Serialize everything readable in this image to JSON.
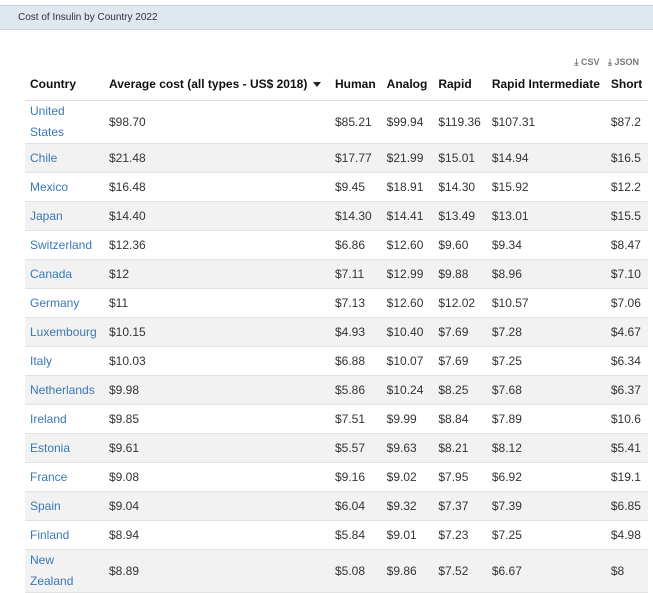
{
  "title": "Cost of Insulin by Country 2022",
  "downloads": {
    "csv": "⤓ CSV",
    "json": "⤓ JSON"
  },
  "columns": [
    "Country",
    "Average cost (all types - US$ 2018)",
    "Human",
    "Analog",
    "Rapid",
    "Rapid Intermediate",
    "Short"
  ],
  "rows": [
    [
      "United States",
      "$98.70",
      "$85.21",
      "$99.94",
      "$119.36",
      "$107.31",
      "$87.2"
    ],
    [
      "Chile",
      "$21.48",
      "$17.77",
      "$21.99",
      "$15.01",
      "$14.94",
      "$16.5"
    ],
    [
      "Mexico",
      "$16.48",
      "$9.45",
      "$18.91",
      "$14.30",
      "$15.92",
      "$12.2"
    ],
    [
      "Japan",
      "$14.40",
      "$14.30",
      "$14.41",
      "$13.49",
      "$13.01",
      "$15.5"
    ],
    [
      "Switzerland",
      "$12.36",
      "$6.86",
      "$12.60",
      "$9.60",
      "$9.34",
      "$8.47"
    ],
    [
      "Canada",
      "$12",
      "$7.11",
      "$12.99",
      "$9.88",
      "$8.96",
      "$7.10"
    ],
    [
      "Germany",
      "$11",
      "$7.13",
      "$12.60",
      "$12.02",
      "$10.57",
      "$7.06"
    ],
    [
      "Luxembourg",
      "$10.15",
      "$4.93",
      "$10.40",
      "$7.69",
      "$7.28",
      "$4.67"
    ],
    [
      "Italy",
      "$10.03",
      "$6.88",
      "$10.07",
      "$7.69",
      "$7.25",
      "$6.34"
    ],
    [
      "Netherlands",
      "$9.98",
      "$5.86",
      "$10.24",
      "$8.25",
      "$7.68",
      "$6.37"
    ],
    [
      "Ireland",
      "$9.85",
      "$7.51",
      "$9.99",
      "$8.84",
      "$7.89",
      "$10.6"
    ],
    [
      "Estonia",
      "$9.61",
      "$5.57",
      "$9.63",
      "$8.21",
      "$8.12",
      "$5.41"
    ],
    [
      "France",
      "$9.08",
      "$9.16",
      "$9.02",
      "$7.95",
      "$6.92",
      "$19.1"
    ],
    [
      "Spain",
      "$9.04",
      "$6.04",
      "$9.32",
      "$7.37",
      "$7.39",
      "$6.85"
    ],
    [
      "Finland",
      "$8.94",
      "$5.84",
      "$9.01",
      "$7.23",
      "$7.25",
      "$4.98"
    ],
    [
      "New Zealand",
      "$8.89",
      "$5.08",
      "$9.86",
      "$7.52",
      "$6.67",
      "$8"
    ]
  ]
}
